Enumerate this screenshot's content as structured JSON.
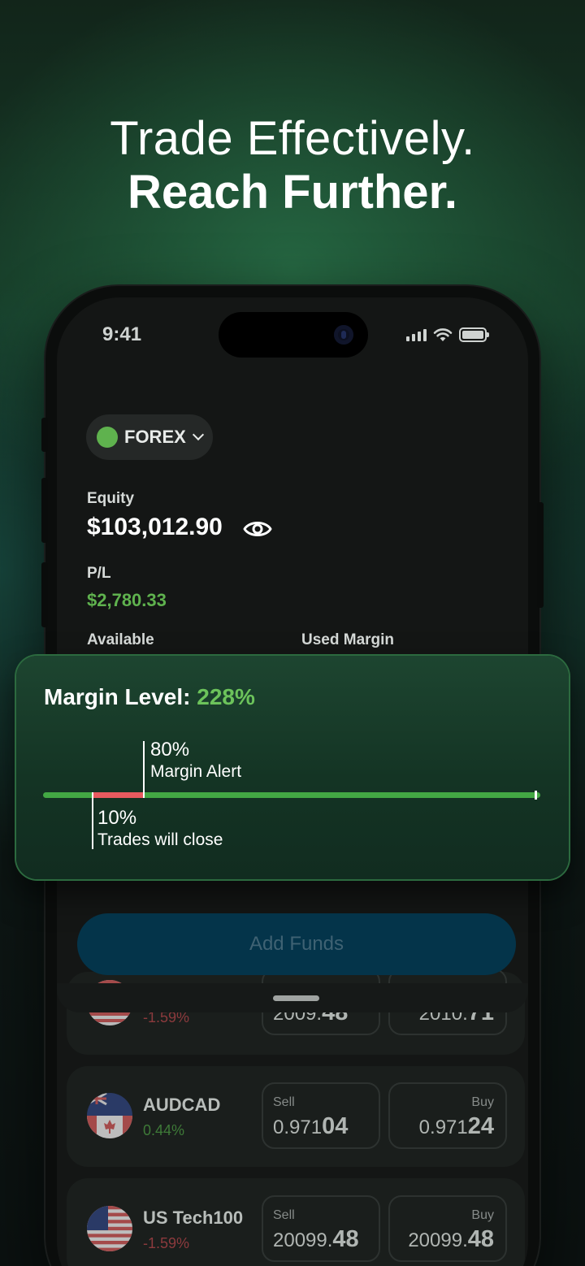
{
  "headline": {
    "line1": "Trade Effectively.",
    "line2": "Reach Further."
  },
  "status_bar": {
    "time": "9:41"
  },
  "account": {
    "type": "FOREX",
    "indicator_color": "#5fb24e"
  },
  "equity": {
    "label": "Equity",
    "value": "$103,012.90"
  },
  "pl": {
    "label": "P/L",
    "value": "$2,780.33",
    "color": "#5fb24e"
  },
  "available": {
    "label": "Available"
  },
  "used_margin": {
    "label": "Used Margin"
  },
  "margin_card": {
    "title": "Margin Level:",
    "percent": "228%",
    "alert": {
      "value": "80%",
      "label": "Margin Alert"
    },
    "close": {
      "value": "10%",
      "label": "Trades will close"
    },
    "colors": {
      "bar": "#43a844",
      "danger": "#e85a5f",
      "accent": "#6cc35b"
    }
  },
  "add_funds": {
    "label": "Add Funds"
  },
  "markets": [
    {
      "symbol": "",
      "change": "-1.59%",
      "sell": {
        "label": "",
        "main": "2009.",
        "big": "48"
      },
      "buy": {
        "label": "",
        "main": "2010.",
        "big": "71"
      }
    },
    {
      "symbol": "AUDCAD",
      "change": "0.44%",
      "sell": {
        "label": "Sell",
        "main": "0.971",
        "big": "04"
      },
      "buy": {
        "label": "Buy",
        "main": "0.971",
        "big": "24"
      }
    },
    {
      "symbol": "US Tech100",
      "change": "-1.59%",
      "sell": {
        "label": "Sell",
        "main": "20099.",
        "big": "48"
      },
      "buy": {
        "label": "Buy",
        "main": "20099.",
        "big": "48"
      }
    }
  ]
}
